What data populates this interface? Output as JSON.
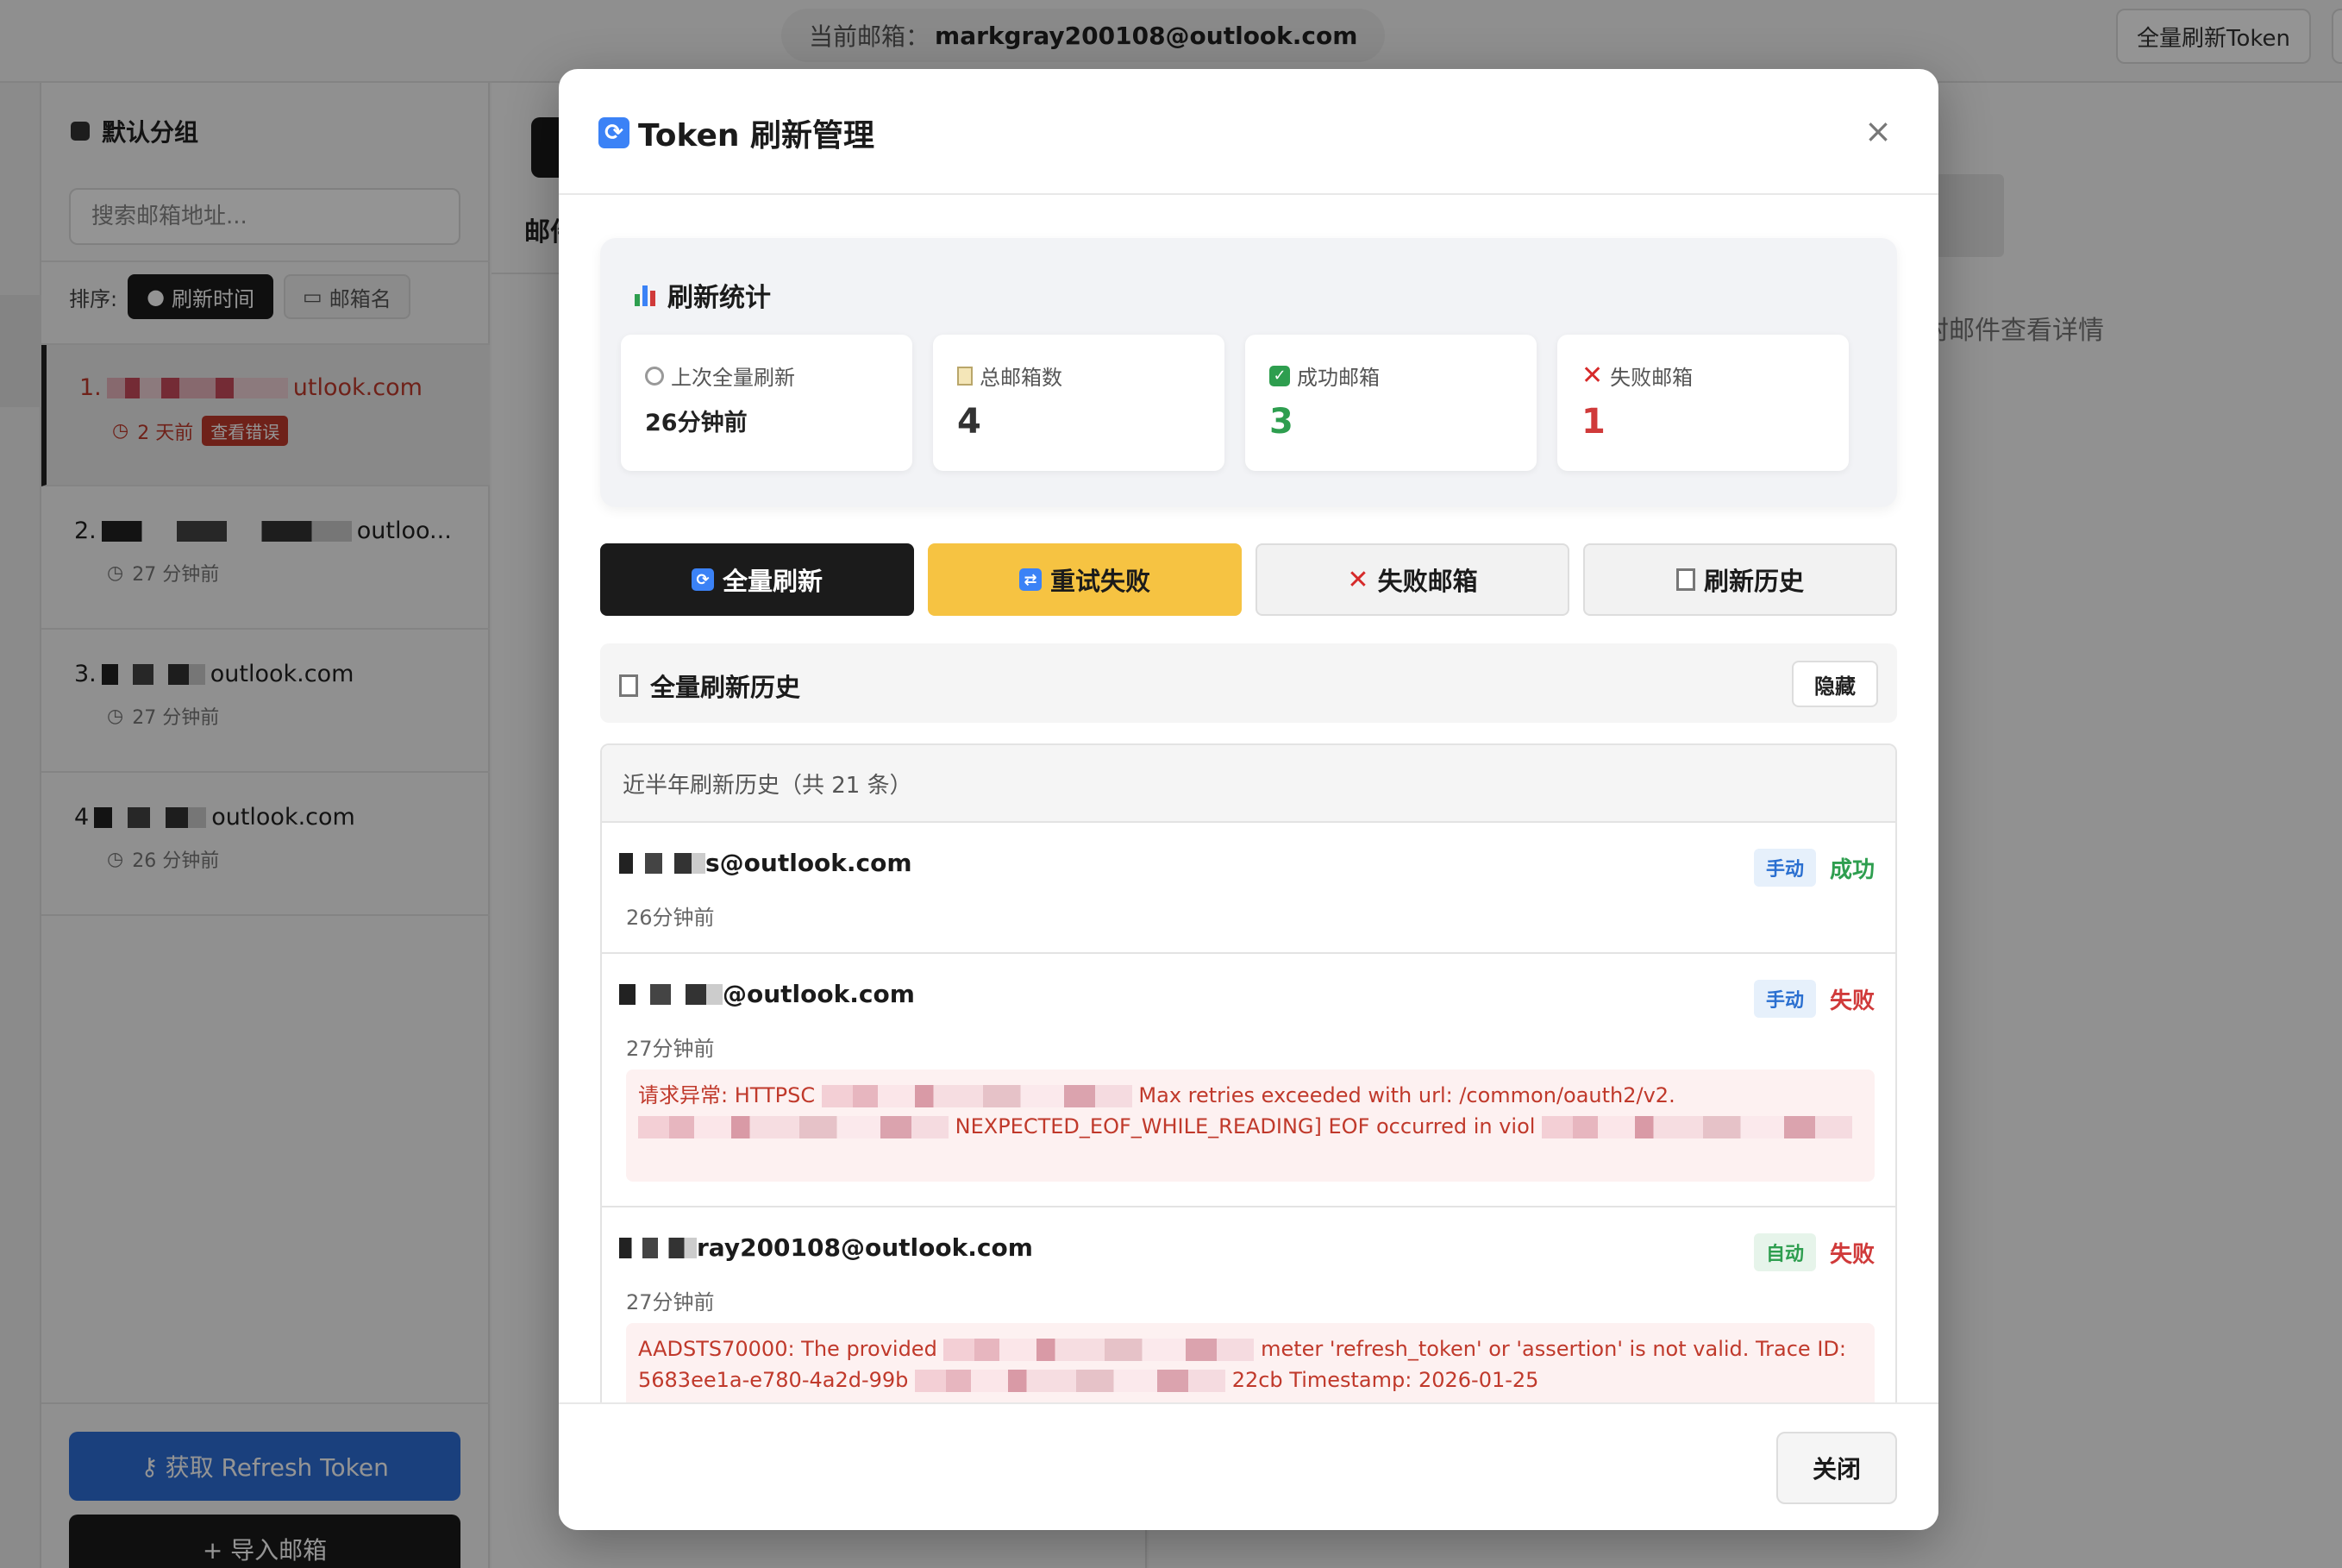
{
  "app": {
    "current_email_label": "当前邮箱：",
    "current_email_value": "markgray200108@outlook.com",
    "refresh_all_token_label": "全量刷新Token"
  },
  "sidebar": {
    "group_name": "默认分组",
    "search_placeholder": "搜索邮箱地址...",
    "sort_label": "排序:",
    "sort_by_time": "刷新时间",
    "sort_by_name": "邮箱名",
    "items": [
      {
        "index": "1.",
        "address_visible": "utlook.com",
        "time": "2 天前",
        "error_badge": "查看错误"
      },
      {
        "index": "2.",
        "address_visible": "outloo...",
        "time": "27 分钟前"
      },
      {
        "index": "3.",
        "address_visible": "outlook.com",
        "time": "27 分钟前"
      },
      {
        "index": "4",
        "address_visible": "outlook.com",
        "time": "26 分钟前"
      }
    ],
    "get_token_label": "获取 Refresh Token",
    "import_label": "+ 导入邮箱"
  },
  "main": {
    "heading_visible": "邮件",
    "detail_hint": "封邮件查看详情"
  },
  "modal": {
    "title": "Token 刷新管理",
    "close_glyph": "×",
    "stats": {
      "title": "刷新统计",
      "cards": [
        {
          "label": "上次全量刷新",
          "value": "26分钟前"
        },
        {
          "label": "总邮箱数",
          "value": "4"
        },
        {
          "label": "成功邮箱",
          "value": "3"
        },
        {
          "label": "失败邮箱",
          "value": "1"
        }
      ]
    },
    "actions": {
      "refresh_all": "全量刷新",
      "retry_failed": "重试失败",
      "failed_emails": "失败邮箱",
      "refresh_history": "刷新历史"
    },
    "history": {
      "title": "全量刷新历史",
      "hide_label": "隐藏",
      "subtitle": "近半年刷新历史（共 21 条）",
      "records": [
        {
          "email_visible": "s@outlook.com",
          "time": "26分钟前",
          "mode": "手动",
          "status": "成功"
        },
        {
          "email_visible": "@outlook.com",
          "time": "27分钟前",
          "mode": "手动",
          "status": "失败",
          "error_part1": "请求异常: HTTPSC",
          "error_part2": "Max retries exceeded with url: /common/oauth2/v2.",
          "error_part3": "NEXPECTED_EOF_WHILE_READING] EOF occurred in viol"
        },
        {
          "email_visible": "ray200108@outlook.com",
          "time": "27分钟前",
          "mode": "自动",
          "status": "失败",
          "error_part1": "AADSTS70000: The provided",
          "error_part2": "meter 'refresh_token' or 'assertion' is not valid. Trace ID: 5683ee1a-e780-4a2d-99b",
          "error_part3": "22cb Timestamp: 2026-01-25"
        }
      ]
    },
    "close_label": "关闭"
  },
  "colors": {
    "primary_dark": "#1b1b1b",
    "accent_yellow": "#f6c342",
    "success": "#2e9e4f",
    "danger": "#d03a3a",
    "link_blue": "#2e6fd8"
  }
}
